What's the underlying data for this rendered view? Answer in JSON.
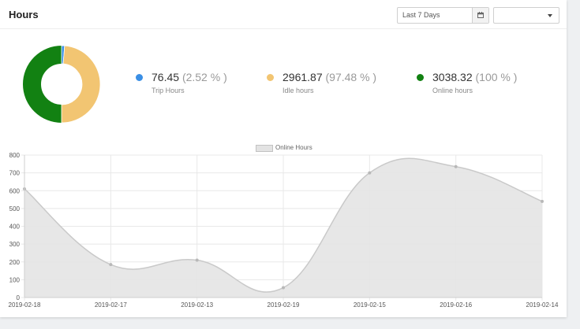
{
  "header": {
    "title": "Hours",
    "date_range": "Last 7 Days",
    "select_value": ""
  },
  "stats": [
    {
      "value": "76.45",
      "percent": "(2.52 % )",
      "label": "Trip Hours",
      "color": "#3a8fe5"
    },
    {
      "value": "2961.87",
      "percent": "(97.48 % )",
      "label": "Idle hours",
      "color": "#f2c572"
    },
    {
      "value": "3038.32",
      "percent": "(100 % )",
      "label": "Online hours",
      "color": "#128112"
    }
  ],
  "donut": {
    "slices": [
      {
        "name": "Trip Hours",
        "value": 76.45,
        "color": "#3a8fe5"
      },
      {
        "name": "Idle hours",
        "value": 2961.87,
        "color": "#f2c572"
      },
      {
        "name": "Online hours",
        "value": 3038.32,
        "color": "#128112"
      }
    ]
  },
  "chart_data": {
    "type": "area",
    "categories": [
      "2019-02-18",
      "2019-02-17",
      "2019-02-13",
      "2019-02-19",
      "2019-02-15",
      "2019-02-16",
      "2019-02-14"
    ],
    "series": [
      {
        "name": "Online Hours",
        "values": [
          610,
          185,
          210,
          55,
          700,
          735,
          540
        ]
      }
    ],
    "ylim": [
      0,
      800
    ],
    "yticks": [
      0,
      100,
      200,
      300,
      400,
      500,
      600,
      700,
      800
    ],
    "grid": true,
    "legend": "top-center",
    "colors": {
      "fill": "#e4e4e4",
      "line": "#c9c9c9",
      "point": "#b8b8b8"
    }
  }
}
